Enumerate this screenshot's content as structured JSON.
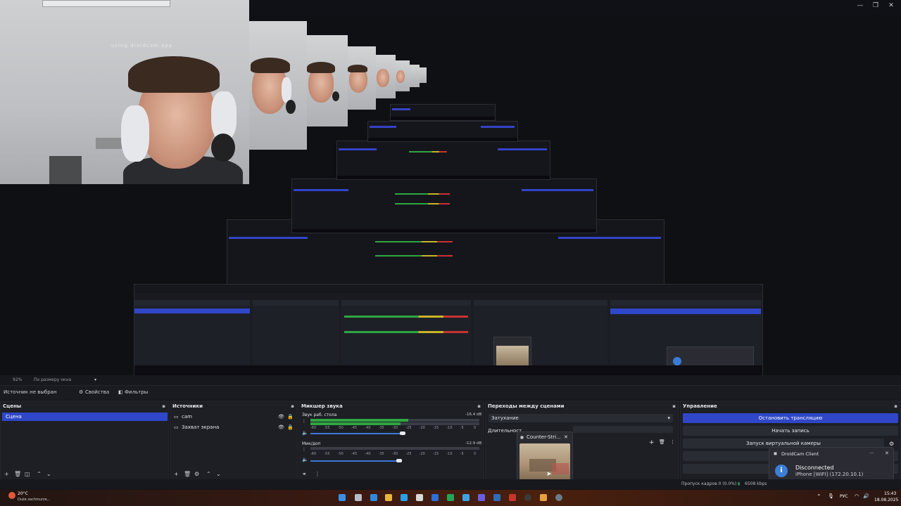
{
  "window": {
    "minimize_glyph": "—",
    "maximize_glyph": "❐",
    "close_glyph": "✕"
  },
  "cam": {
    "watermark": "using droidcam.app"
  },
  "status": {
    "zoom": "92%",
    "fit_label": "По размеру окна"
  },
  "toolbar": {
    "no_source": "Источник не выбран",
    "properties": "Свойства",
    "filters": "Фильтры"
  },
  "scenes": {
    "title": "Сцены",
    "items": [
      "Сцена"
    ]
  },
  "sources": {
    "title": "Источники",
    "items": [
      {
        "label": "cam"
      },
      {
        "label": "Захват экрана"
      }
    ]
  },
  "mixer": {
    "title": "Микшер звука",
    "channels": [
      {
        "name": "Звук раб. стола",
        "db": "-16.4 dB",
        "level": 0.58,
        "volume": 0.88
      },
      {
        "name": "Мик/доп",
        "db": "-12.9 dB",
        "level": 0.0,
        "volume": 0.85
      }
    ],
    "ticks": [
      "-60",
      "-55",
      "-50",
      "-45",
      "-40",
      "-35",
      "-30",
      "-25",
      "-20",
      "-15",
      "-10",
      "-5",
      "0"
    ]
  },
  "transitions": {
    "title": "Переходы между сценами",
    "selected": "Затухание",
    "duration_label": "Длительност"
  },
  "controls": {
    "title": "Управление",
    "stop_stream": "Остановить трансляцию",
    "start_record": "Начать запись",
    "virtual_cam": "Запуск виртуальной камеры"
  },
  "popup": {
    "title": "Counter-Stri...",
    "close": "✕"
  },
  "notification": {
    "app": "DroidCam Client",
    "title": "Disconnected",
    "body": "iPhone [WIFI] (172.20.10.1)",
    "more": "···",
    "close": "✕",
    "icon": "info-icon"
  },
  "footer": {
    "dropped": "Пропуск кадров 0 (0.0%)",
    "bitrate": "6508 kbps"
  },
  "taskbar": {
    "weather_temp": "20°C",
    "weather_text": "Duże zachmurze...",
    "lang": "РУС",
    "time": "15:43",
    "date": "18.08.2025"
  },
  "colors": {
    "accent": "#2f47c8",
    "meter_green": "#2fa642",
    "meter_yellow": "#c8b42a",
    "meter_red": "#c83232"
  }
}
